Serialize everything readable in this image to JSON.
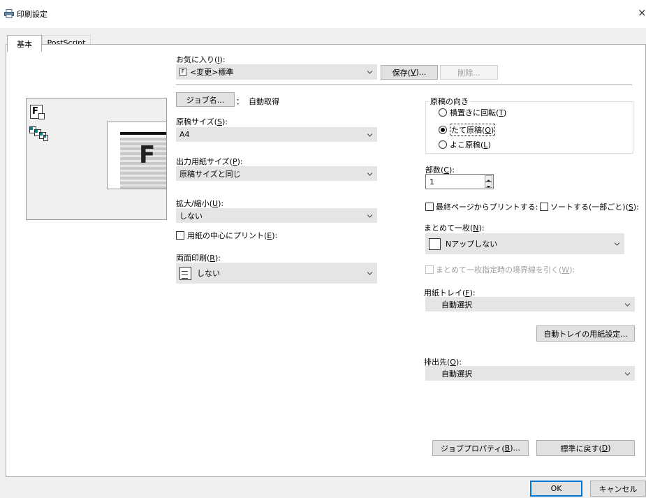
{
  "window": {
    "title": "印刷設定",
    "close_glyph": "×"
  },
  "tabs": [
    {
      "label": "基本",
      "active": true
    },
    {
      "label": "PostScript",
      "active": false
    }
  ],
  "favorites": {
    "label_prefix": "お気に入り(",
    "label_key": "I",
    "label_suffix": "):",
    "value": "<変更>標準",
    "icon_letter": "F",
    "save_prefix": "保存(",
    "save_key": "V",
    "save_suffix": ")...",
    "delete_label": "削除..."
  },
  "job": {
    "button_label": "ジョブ名...",
    "separator": "：",
    "value": "自動取得"
  },
  "original_size": {
    "label_prefix": "原稿サイズ(",
    "label_key": "S",
    "label_suffix": "):",
    "value": "A4"
  },
  "output_size": {
    "label_prefix": "出力用紙サイズ(",
    "label_key": "P",
    "label_suffix": "):",
    "value": "原稿サイズと同じ"
  },
  "zoom": {
    "label_prefix": "拡大/縮小(",
    "label_key": "U",
    "label_suffix": "):",
    "value": "しない"
  },
  "center_print": {
    "label_prefix": "用紙の中心にプリント(",
    "label_key": "E",
    "label_suffix": "):",
    "checked": false
  },
  "duplex": {
    "label_prefix": "両面印刷(",
    "label_key": "R",
    "label_suffix": "):",
    "value": "しない"
  },
  "orientation": {
    "group_label": "原稿の向き",
    "options": [
      {
        "prefix": "横置きに回転(",
        "key": "T",
        "suffix": ")",
        "selected": false
      },
      {
        "prefix": "たて原稿(",
        "key": "O",
        "suffix": ")",
        "selected": true
      },
      {
        "prefix": "よこ原稿(",
        "key": "L",
        "suffix": ")",
        "selected": false
      }
    ]
  },
  "copies": {
    "label_prefix": "部数(",
    "label_key": "C",
    "label_suffix": "):",
    "value": "1"
  },
  "last_page": {
    "label": "最終ページからプリントする:",
    "checked": false
  },
  "collate": {
    "label_prefix": "ソートする(一部ごと)(",
    "label_key": "S",
    "label_suffix": "):",
    "checked": false
  },
  "nup": {
    "label_prefix": "まとめて一枚(",
    "label_key": "N",
    "label_suffix": "):",
    "value": "Nアップしない"
  },
  "border": {
    "label_prefix": "まとめて一枚指定時の境界線を引く(",
    "label_key": "W",
    "label_suffix": "):",
    "enabled": false
  },
  "tray": {
    "label_prefix": "用紙トレイ(",
    "label_key": "F",
    "label_suffix": "):",
    "value": "自動選択",
    "settings_button": "自動トレイの用紙設定..."
  },
  "output": {
    "label_prefix": "排出先(",
    "label_key": "O",
    "label_suffix": "):",
    "value": "自動選択"
  },
  "bottom_buttons": {
    "job_prop_prefix": "ジョブプロパティ(",
    "job_prop_key": "B",
    "job_prop_suffix": ")...",
    "reset_prefix": "標準に戻す(",
    "reset_key": "D",
    "reset_suffix": ")"
  },
  "dialog": {
    "ok": "OK",
    "cancel": "キャンセル"
  },
  "preview": {
    "letter": "F",
    "big_letter": "F"
  },
  "colors": {
    "accent": "#0078d7",
    "teal": "#008080",
    "control": "#e5e5e5"
  }
}
